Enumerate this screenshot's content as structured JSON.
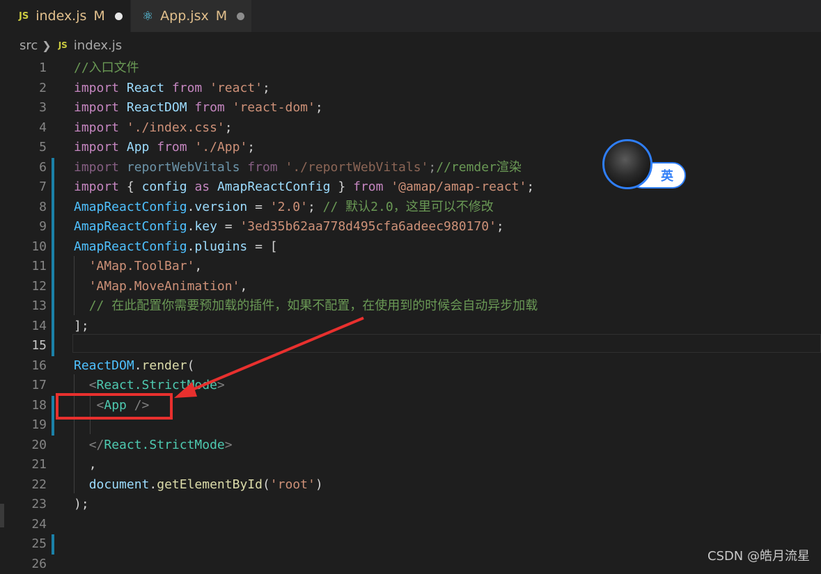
{
  "tabs": [
    {
      "icon": "JS",
      "label": "index.js",
      "modified": "M"
    },
    {
      "icon": "⚛",
      "label": "App.jsx",
      "modified": "M"
    }
  ],
  "breadcrumb": {
    "folder": "src",
    "file_icon": "JS",
    "file": "index.js"
  },
  "line_numbers": [
    "1",
    "2",
    "3",
    "4",
    "5",
    "6",
    "7",
    "8",
    "9",
    "10",
    "11",
    "12",
    "13",
    "14",
    "15",
    "16",
    "17",
    "18",
    "19",
    "20",
    "21",
    "22",
    "23",
    "24",
    "25",
    "26"
  ],
  "code": {
    "l1": {
      "comment": "//入口文件"
    },
    "l2": {
      "kw": "import",
      "name": "React",
      "from": "from",
      "str": "'react'",
      "end": ";"
    },
    "l3": {
      "kw": "import",
      "name": "ReactDOM",
      "from": "from",
      "str": "'react-dom'",
      "end": ";"
    },
    "l4": {
      "kw": "import",
      "str": "'./index.css'",
      "end": ";"
    },
    "l5": {
      "kw": "import",
      "name": "App",
      "from": "from",
      "str": "'./App'",
      "end": ";"
    },
    "l6": {
      "kw": "import",
      "name": "reportWebVitals",
      "from": "from",
      "str": "'./reportWebVitals'",
      "end": ";",
      "comment": "//remder渲染"
    },
    "l7": {
      "kw": "import",
      "open": "{",
      "name": "config",
      "as": "as",
      "alias": "AmapReactConfig",
      "close": "}",
      "from": "from",
      "str": "'@amap/amap-react'",
      "end": ";"
    },
    "l8": {
      "obj": "AmapReactConfig",
      "prop": "version",
      "eq": "=",
      "str": "'2.0'",
      "end": ";",
      "comment": "// 默认2.0，这里可以不修改"
    },
    "l9": {
      "obj": "AmapReactConfig",
      "prop": "key",
      "eq": "=",
      "str": "'3ed35b62aa778d495cfa6adeec980170'",
      "end": ";"
    },
    "l10": {
      "obj": "AmapReactConfig",
      "prop": "plugins",
      "eq": "=",
      "open": "["
    },
    "l11": {
      "str": "'AMap.ToolBar'",
      "end": ","
    },
    "l12": {
      "str": "'AMap.MoveAnimation'",
      "end": ","
    },
    "l13": {
      "comment": "// 在此配置你需要预加载的插件，如果不配置，在使用到的时候会自动异步加载"
    },
    "l14": {
      "close": "];"
    },
    "l16": {
      "obj": "ReactDOM",
      "method": "render",
      "open": "("
    },
    "l17": {
      "lt": "<",
      "tag": "React.StrictMode",
      "gt": ">"
    },
    "l18": {
      "lt": "<",
      "tag": "App",
      "gt": "/>"
    },
    "l20": {
      "lt": "</",
      "tag": "React.StrictMode",
      "gt": ">"
    },
    "l21": {
      "comma": ","
    },
    "l22": {
      "obj": "document",
      "method": "getElementById",
      "open": "(",
      "str": "'root'",
      "close": ")"
    },
    "l23": {
      "close": ");"
    }
  },
  "ime": {
    "label": "英"
  },
  "watermark": "CSDN @皓月流星",
  "colors": {
    "annotation_red": "#e8302e",
    "ime_blue": "#2f7ef7",
    "git_gutter_blue": "#1b81a8"
  }
}
